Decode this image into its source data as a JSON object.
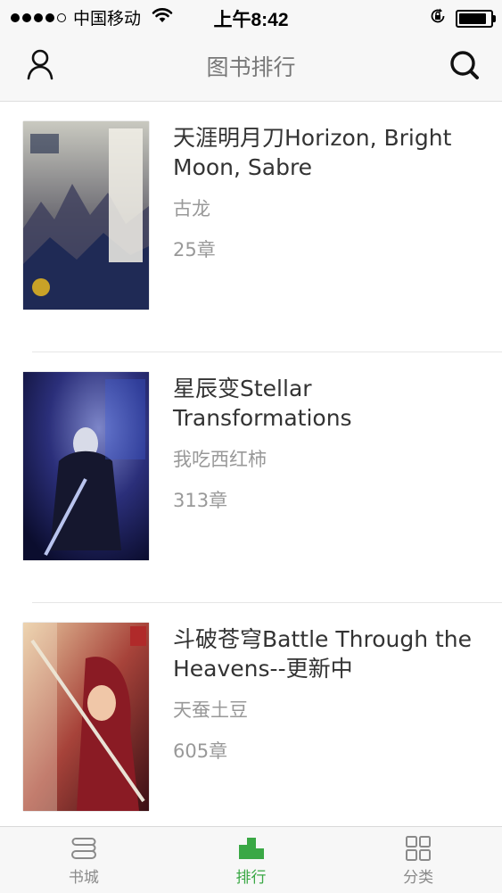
{
  "status_bar": {
    "carrier": "中国移动",
    "time": "上午8:42",
    "battery_level": 0.9
  },
  "header": {
    "title": "图书排行",
    "left_icon": "user-icon",
    "right_icon": "search-icon"
  },
  "books": [
    {
      "title": "天涯明月刀Horizon, Bright Moon, Sabre",
      "author": "古龙",
      "chapters": "25章"
    },
    {
      "title": "星辰变Stellar Transformations",
      "author": "我吃西红柿",
      "chapters": "313章"
    },
    {
      "title": "斗破苍穹Battle Through the Heavens--更新中",
      "author": "天蚕土豆",
      "chapters": "605章"
    }
  ],
  "tabs": [
    {
      "label": "书城",
      "icon": "bookstore-icon",
      "active": false
    },
    {
      "label": "排行",
      "icon": "ranking-icon",
      "active": true
    },
    {
      "label": "分类",
      "icon": "category-icon",
      "active": false
    }
  ],
  "colors": {
    "accent": "#3aa845",
    "secondary_text": "#999999",
    "bar_background": "#f7f7f7"
  }
}
